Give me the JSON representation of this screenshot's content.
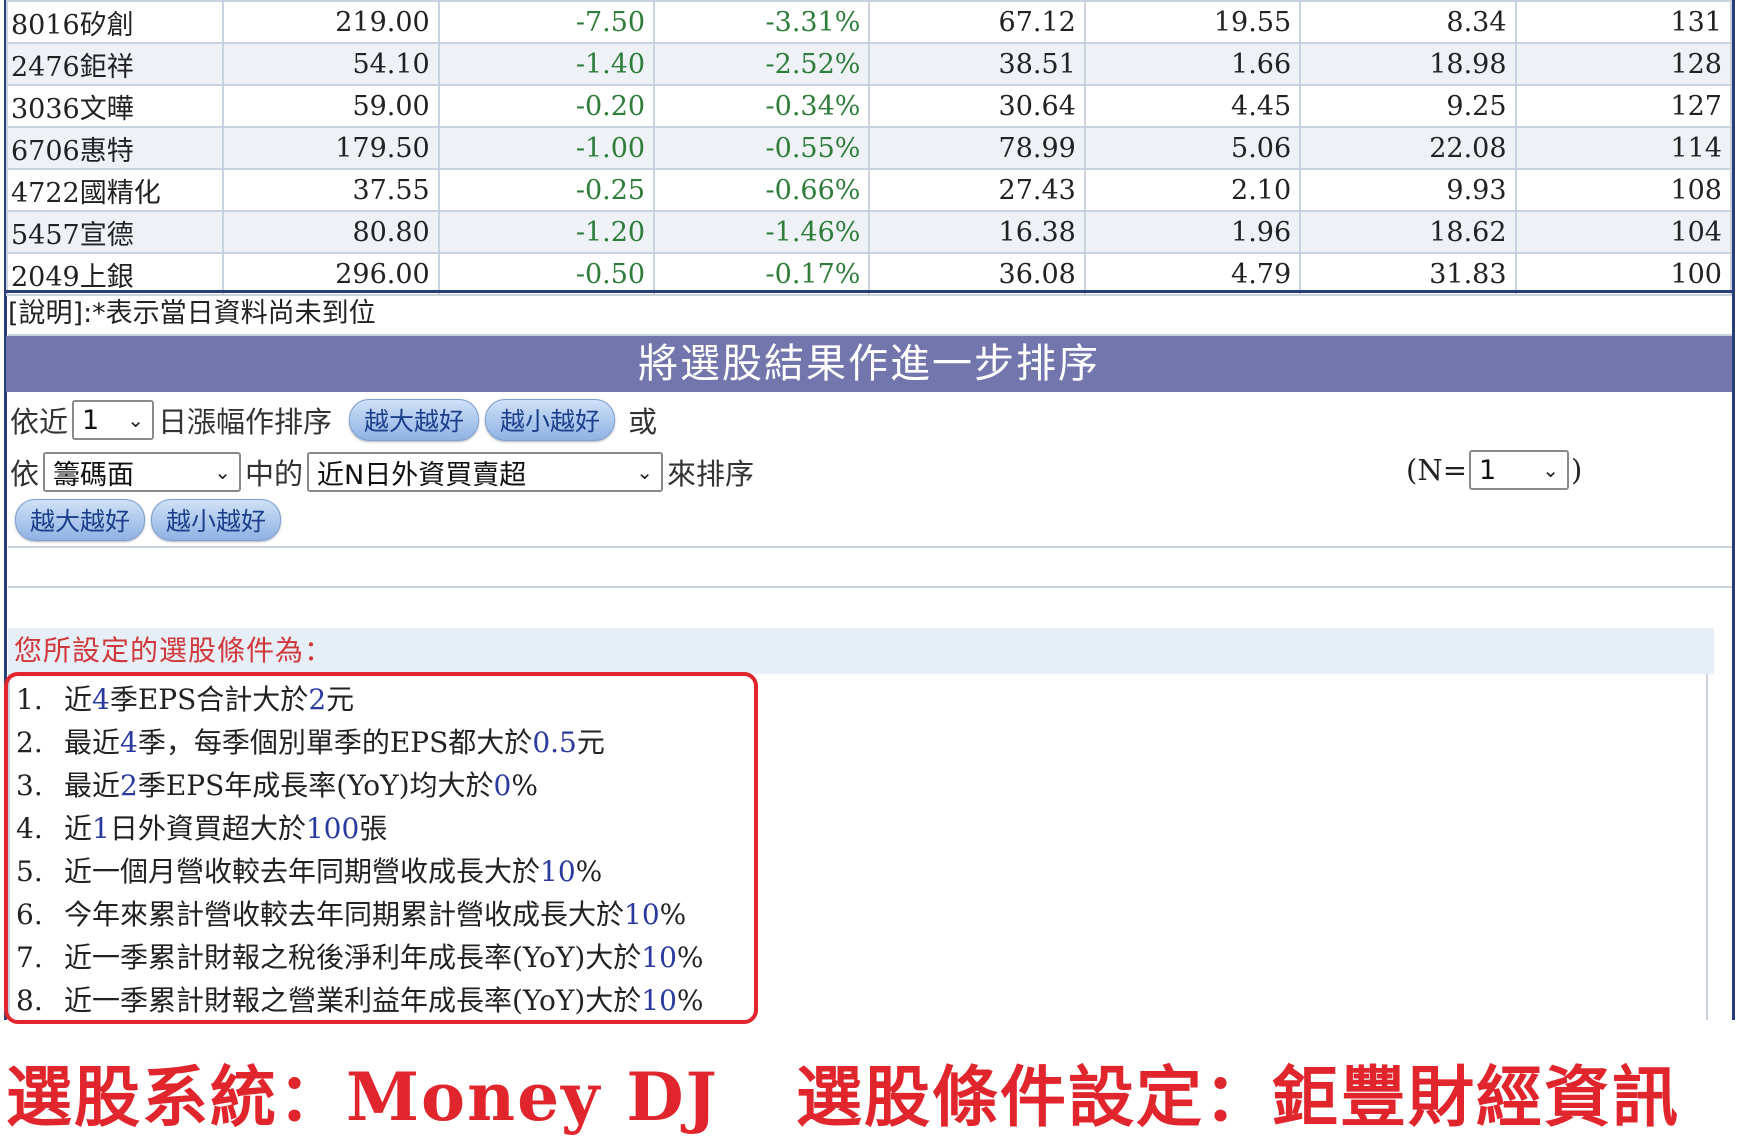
{
  "results": {
    "rows": [
      {
        "name": "8016矽創",
        "price": "219.00",
        "change": "-7.50",
        "pct": "-3.31%",
        "v1": "67.12",
        "v2": "19.55",
        "v3": "8.34",
        "v4": "131"
      },
      {
        "name": "2476鉅祥",
        "price": "54.10",
        "change": "-1.40",
        "pct": "-2.52%",
        "v1": "38.51",
        "v2": "1.66",
        "v3": "18.98",
        "v4": "128"
      },
      {
        "name": "3036文曄",
        "price": "59.00",
        "change": "-0.20",
        "pct": "-0.34%",
        "v1": "30.64",
        "v2": "4.45",
        "v3": "9.25",
        "v4": "127"
      },
      {
        "name": "6706惠特",
        "price": "179.50",
        "change": "-1.00",
        "pct": "-0.55%",
        "v1": "78.99",
        "v2": "5.06",
        "v3": "22.08",
        "v4": "114"
      },
      {
        "name": "4722國精化",
        "price": "37.55",
        "change": "-0.25",
        "pct": "-0.66%",
        "v1": "27.43",
        "v2": "2.10",
        "v3": "9.93",
        "v4": "108"
      },
      {
        "name": "5457宣德",
        "price": "80.80",
        "change": "-1.20",
        "pct": "-1.46%",
        "v1": "16.38",
        "v2": "1.96",
        "v3": "18.62",
        "v4": "104"
      },
      {
        "name": "2049上銀",
        "price": "296.00",
        "change": "-0.50",
        "pct": "-0.17%",
        "v1": "36.08",
        "v2": "4.79",
        "v3": "31.83",
        "v4": "100"
      }
    ],
    "note": "[說明]:*表示當日資料尚未到位"
  },
  "sort_section": {
    "title": "將選股結果作進一步排序",
    "row1": {
      "prefix": "依近",
      "days_value": "1",
      "suffix": "日漲幅作排序",
      "btn_desc": "越大越好",
      "btn_asc": "越小越好",
      "or_text": "或"
    },
    "row2": {
      "prefix": "依",
      "category_value": "籌碼面",
      "mid": "中的",
      "metric_value": "近N日外資買賣超",
      "suffix": "來排序",
      "n_prefix": "(N=",
      "n_value": "1",
      "n_suffix": ")"
    },
    "row3": {
      "btn_desc": "越大越好",
      "btn_asc": "越小越好"
    }
  },
  "conditions": {
    "header": "您所設定的選股條件為：",
    "items": [
      {
        "idx": "1.",
        "parts": [
          {
            "t": "近"
          },
          {
            "t": "4",
            "h": true
          },
          {
            "t": "季EPS合計大於"
          },
          {
            "t": "2",
            "h": true
          },
          {
            "t": "元"
          }
        ]
      },
      {
        "idx": "2.",
        "parts": [
          {
            "t": "最近"
          },
          {
            "t": "4",
            "h": true
          },
          {
            "t": "季，每季個別單季的EPS都大於"
          },
          {
            "t": "0.5",
            "h": true
          },
          {
            "t": "元"
          }
        ]
      },
      {
        "idx": "3.",
        "parts": [
          {
            "t": "最近"
          },
          {
            "t": "2",
            "h": true
          },
          {
            "t": "季EPS年成長率(YoY)均大於"
          },
          {
            "t": "0",
            "h": true
          },
          {
            "t": "%"
          }
        ]
      },
      {
        "idx": "4.",
        "parts": [
          {
            "t": "近"
          },
          {
            "t": "1",
            "h": true
          },
          {
            "t": "日外資買超大於"
          },
          {
            "t": "100",
            "h": true
          },
          {
            "t": "張"
          }
        ]
      },
      {
        "idx": "5.",
        "parts": [
          {
            "t": "近一個月營收較去年同期營收成長大於"
          },
          {
            "t": "10",
            "h": true
          },
          {
            "t": "%"
          }
        ]
      },
      {
        "idx": "6.",
        "parts": [
          {
            "t": "今年來累計營收較去年同期累計營收成長大於"
          },
          {
            "t": "10",
            "h": true
          },
          {
            "t": "%"
          }
        ]
      },
      {
        "idx": "7.",
        "parts": [
          {
            "t": "近一季累計財報之稅後淨利年成長率(YoY)大於"
          },
          {
            "t": "10",
            "h": true
          },
          {
            "t": "%"
          }
        ]
      },
      {
        "idx": "8.",
        "parts": [
          {
            "t": "近一季累計財報之營業利益年成長率(YoY)大於"
          },
          {
            "t": "10",
            "h": true
          },
          {
            "t": "%"
          }
        ]
      }
    ]
  },
  "footer": {
    "left": "選股系統：Money DJ",
    "right": "選股條件設定：鉅豐財經資訊"
  },
  "colors": {
    "header_bg": "#7376ad",
    "negative": "#2f7d3a",
    "highlight": "#2b3a9e",
    "annotation_red": "#e0262c"
  }
}
